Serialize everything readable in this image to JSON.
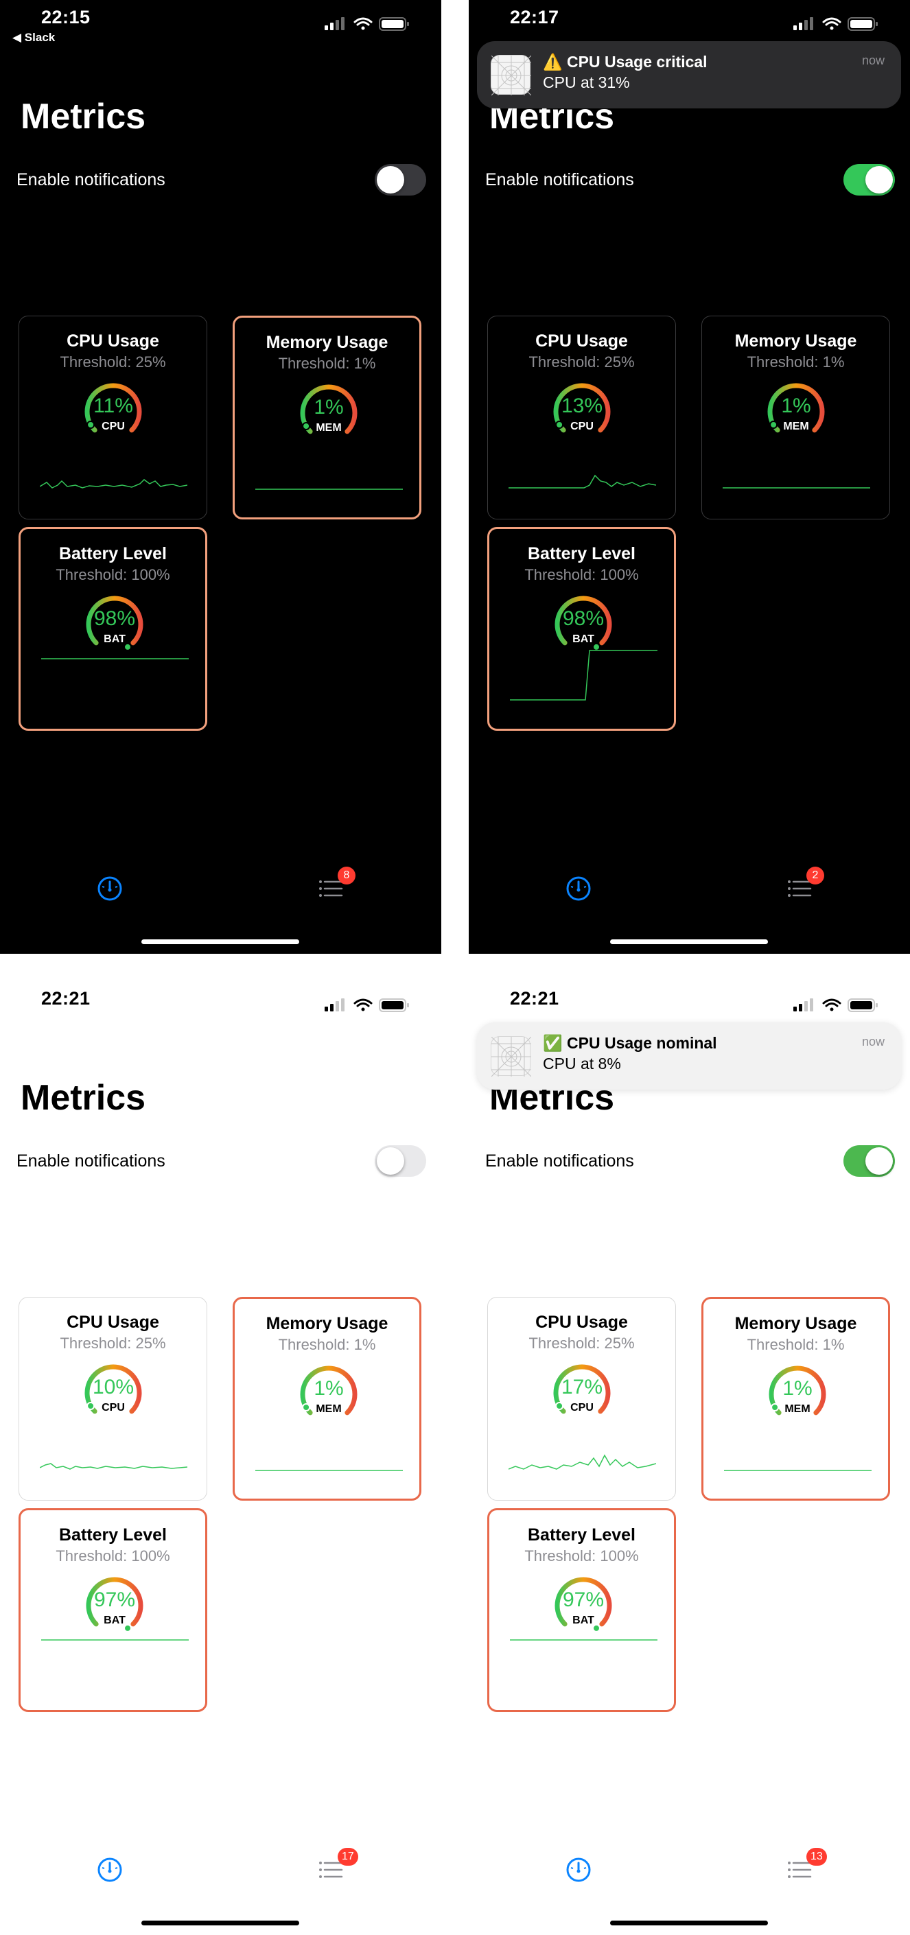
{
  "colors": {
    "accent": "#0a84ff",
    "gauge_green": "#34c759",
    "gauge_orange": "#f39c12",
    "gauge_red": "#e74c3c",
    "alert_dark": "#f2a07d",
    "alert_light": "#e8684a",
    "badge": "#ff3b30"
  },
  "screens": [
    {
      "theme": "dark",
      "status": {
        "time": "22:15",
        "back": "◀ Slack"
      },
      "title": "Metrics",
      "notifications": {
        "label": "Enable notifications",
        "enabled": false
      },
      "cards": [
        {
          "title": "CPU Usage",
          "threshold": "Threshold: 25%",
          "value": "11%",
          "unit": "CPU",
          "alert": false,
          "icon": "gauge"
        },
        {
          "title": "Memory Usage",
          "threshold": "Threshold: 1%",
          "value": "1%",
          "unit": "MEM",
          "alert": true,
          "icon": "gauge"
        },
        {
          "title": "Battery Level",
          "threshold": "Threshold: 100%",
          "value": "98%",
          "unit": "BAT",
          "alert": true,
          "icon": "gauge"
        }
      ],
      "tabbar": {
        "dashboard_icon": "gauge-icon",
        "list_icon": "list-icon",
        "badge": "8"
      }
    },
    {
      "theme": "dark",
      "status": {
        "time": "22:17"
      },
      "banner": {
        "title": "⚠️ CPU Usage critical",
        "body": "CPU at 31%",
        "time": "now",
        "icon": "app-icon"
      },
      "title": "Metrics",
      "notifications": {
        "label": "Enable notifications",
        "enabled": true
      },
      "cards": [
        {
          "title": "CPU Usage",
          "threshold": "Threshold: 25%",
          "value": "13%",
          "unit": "CPU",
          "alert": false
        },
        {
          "title": "Memory Usage",
          "threshold": "Threshold: 1%",
          "value": "1%",
          "unit": "MEM",
          "alert": false
        },
        {
          "title": "Battery Level",
          "threshold": "Threshold: 100%",
          "value": "98%",
          "unit": "BAT",
          "alert": true
        }
      ],
      "tabbar": {
        "dashboard_icon": "gauge-icon",
        "list_icon": "list-icon",
        "badge": "2"
      }
    },
    {
      "theme": "light",
      "status": {
        "time": "22:21"
      },
      "title": "Metrics",
      "notifications": {
        "label": "Enable notifications",
        "enabled": false
      },
      "cards": [
        {
          "title": "CPU Usage",
          "threshold": "Threshold: 25%",
          "value": "10%",
          "unit": "CPU",
          "alert": false
        },
        {
          "title": "Memory Usage",
          "threshold": "Threshold: 1%",
          "value": "1%",
          "unit": "MEM",
          "alert": true
        },
        {
          "title": "Battery Level",
          "threshold": "Threshold: 100%",
          "value": "97%",
          "unit": "BAT",
          "alert": true
        }
      ],
      "tabbar": {
        "dashboard_icon": "gauge-icon",
        "list_icon": "list-icon",
        "badge": "17"
      }
    },
    {
      "theme": "light",
      "status": {
        "time": "22:21"
      },
      "banner": {
        "title": "✅ CPU Usage nominal",
        "body": "CPU at 8%",
        "time": "now",
        "icon": "app-icon"
      },
      "title": "Metrics",
      "notifications": {
        "label": "Enable notifications",
        "enabled": true
      },
      "cards": [
        {
          "title": "CPU Usage",
          "threshold": "Threshold: 25%",
          "value": "17%",
          "unit": "CPU",
          "alert": false
        },
        {
          "title": "Memory Usage",
          "threshold": "Threshold: 1%",
          "value": "1%",
          "unit": "MEM",
          "alert": true
        },
        {
          "title": "Battery Level",
          "threshold": "Threshold: 100%",
          "value": "97%",
          "unit": "BAT",
          "alert": true
        }
      ],
      "tabbar": {
        "dashboard_icon": "gauge-icon",
        "list_icon": "list-icon",
        "badge": "13"
      }
    }
  ]
}
